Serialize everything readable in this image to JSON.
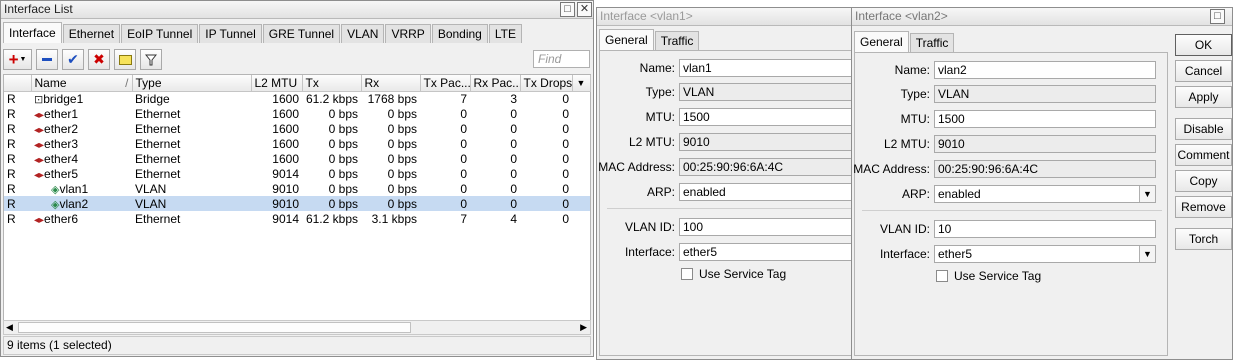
{
  "list": {
    "title": "Interface List",
    "tabs": [
      "Interface",
      "Ethernet",
      "EoIP Tunnel",
      "IP Tunnel",
      "GRE Tunnel",
      "VLAN",
      "VRRP",
      "Bonding",
      "LTE"
    ],
    "find_placeholder": "Find",
    "columns": [
      "Name",
      "Type",
      "L2 MTU",
      "Tx",
      "Rx",
      "Tx Pac...",
      "Rx Pac...",
      "Tx Drops"
    ],
    "rows": [
      {
        "flag": "R",
        "name": "bridge1",
        "type": "Bridge",
        "l2mtu": "1600",
        "tx": "61.2 kbps",
        "rx": "1768 bps",
        "txp": "7",
        "rxp": "3",
        "txd": "0"
      },
      {
        "flag": "R",
        "name": "ether1",
        "type": "Ethernet",
        "l2mtu": "1600",
        "tx": "0 bps",
        "rx": "0 bps",
        "txp": "0",
        "rxp": "0",
        "txd": "0"
      },
      {
        "flag": "R",
        "name": "ether2",
        "type": "Ethernet",
        "l2mtu": "1600",
        "tx": "0 bps",
        "rx": "0 bps",
        "txp": "0",
        "rxp": "0",
        "txd": "0"
      },
      {
        "flag": "R",
        "name": "ether3",
        "type": "Ethernet",
        "l2mtu": "1600",
        "tx": "0 bps",
        "rx": "0 bps",
        "txp": "0",
        "rxp": "0",
        "txd": "0"
      },
      {
        "flag": "R",
        "name": "ether4",
        "type": "Ethernet",
        "l2mtu": "1600",
        "tx": "0 bps",
        "rx": "0 bps",
        "txp": "0",
        "rxp": "0",
        "txd": "0"
      },
      {
        "flag": "R",
        "name": "ether5",
        "type": "Ethernet",
        "l2mtu": "9014",
        "tx": "0 bps",
        "rx": "0 bps",
        "txp": "0",
        "rxp": "0",
        "txd": "0"
      },
      {
        "flag": "R",
        "name": "vlan1",
        "type": "VLAN",
        "l2mtu": "9010",
        "tx": "0 bps",
        "rx": "0 bps",
        "txp": "0",
        "rxp": "0",
        "txd": "0"
      },
      {
        "flag": "R",
        "name": "vlan2",
        "type": "VLAN",
        "l2mtu": "9010",
        "tx": "0 bps",
        "rx": "0 bps",
        "txp": "0",
        "rxp": "0",
        "txd": "0",
        "selected": true
      },
      {
        "flag": "R",
        "name": "ether6",
        "type": "Ethernet",
        "l2mtu": "9014",
        "tx": "61.2 kbps",
        "rx": "3.1 kbps",
        "txp": "7",
        "rxp": "4",
        "txd": "0"
      }
    ],
    "status": "9 items (1 selected)"
  },
  "vlan1": {
    "title": "Interface <vlan1>",
    "tabs": [
      "General",
      "Traffic"
    ],
    "labels": {
      "name": "Name:",
      "type": "Type:",
      "mtu": "MTU:",
      "l2mtu": "L2 MTU:",
      "mac": "MAC Address:",
      "arp": "ARP:",
      "vlan_id": "VLAN ID:",
      "iface": "Interface:",
      "service_tag": "Use Service Tag"
    },
    "values": {
      "name": "vlan1",
      "type": "VLAN",
      "mtu": "1500",
      "l2mtu": "9010",
      "mac": "00:25:90:96:6A:4C",
      "arp": "enabled",
      "vlan_id": "100",
      "iface": "ether5"
    }
  },
  "vlan2": {
    "title": "Interface <vlan2>",
    "tabs": [
      "General",
      "Traffic"
    ],
    "labels": {
      "name": "Name:",
      "type": "Type:",
      "mtu": "MTU:",
      "l2mtu": "L2 MTU:",
      "mac": "MAC Address:",
      "arp": "ARP:",
      "vlan_id": "VLAN ID:",
      "iface": "Interface:",
      "service_tag": "Use Service Tag"
    },
    "values": {
      "name": "vlan2",
      "type": "VLAN",
      "mtu": "1500",
      "l2mtu": "9010",
      "mac": "00:25:90:96:6A:4C",
      "arp": "enabled",
      "vlan_id": "10",
      "iface": "ether5"
    },
    "buttons": [
      "OK",
      "Cancel",
      "Apply",
      "Disable",
      "Comment",
      "Copy",
      "Remove",
      "Torch"
    ]
  },
  "icons": {
    "add": "plus-icon",
    "remove": "minus-icon",
    "enable": "check-icon",
    "disable": "x-icon",
    "comment": "note-icon",
    "filter": "filter-icon",
    "bridge": "bridge-icon",
    "ethernet": "ethernet-icon",
    "vlan": "vlan-icon"
  },
  "colors": {
    "selected_row": "#c6daf2",
    "add_icon": "#cc0000",
    "check_icon": "#1e4fbf"
  }
}
